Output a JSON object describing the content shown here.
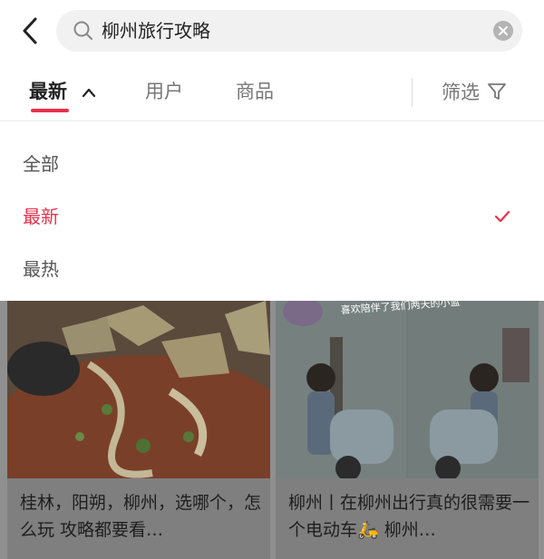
{
  "search": {
    "query": "柳州旅行攻略"
  },
  "tabs": {
    "newest": "最新",
    "users": "用户",
    "goods": "商品",
    "filter": "筛选"
  },
  "sort_options": {
    "all": "全部",
    "newest": "最新",
    "hot": "最热"
  },
  "results": [
    {
      "title": "桂林，阳朔，柳州，选哪个，怎么玩 攻略都要看…"
    },
    {
      "title": "柳州丨在柳州出行真的很需要一个电动车🛵 柳州…",
      "overlay_text": "喜欢陪伴了我们两天的小蓝"
    }
  ],
  "colors": {
    "accent": "#e8324a",
    "search_bg": "#f1f1f1"
  },
  "icons": {
    "back": "chevron-left-icon",
    "search": "search-icon",
    "clear": "clear-icon",
    "caret": "chevron-up-icon",
    "filter": "funnel-icon",
    "selected": "check-icon"
  }
}
